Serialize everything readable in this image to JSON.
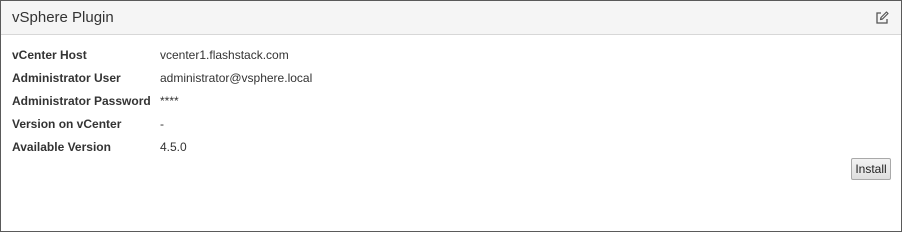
{
  "panel": {
    "title": "vSphere Plugin",
    "edit_icon": "edit-icon"
  },
  "fields": [
    {
      "label": "vCenter Host",
      "value": "vcenter1.flashstack.com"
    },
    {
      "label": "Administrator User",
      "value": "administrator@vsphere.local"
    },
    {
      "label": "Administrator Password",
      "value": "****"
    },
    {
      "label": "Version on vCenter",
      "value": "-"
    },
    {
      "label": "Available Version",
      "value": "4.5.0"
    }
  ],
  "actions": {
    "install_label": "Install"
  }
}
